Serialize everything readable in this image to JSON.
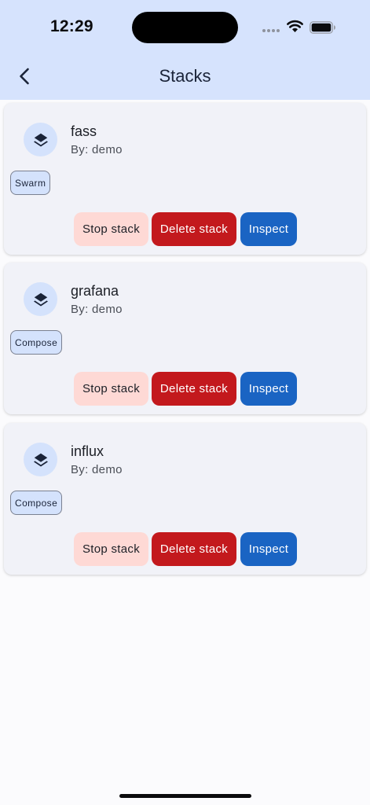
{
  "status_bar": {
    "time": "12:29"
  },
  "header": {
    "title": "Stacks"
  },
  "stacks": [
    {
      "name": "fass",
      "author": "By: demo",
      "type": "Swarm",
      "stop_label": "Stop stack",
      "delete_label": "Delete stack",
      "inspect_label": "Inspect"
    },
    {
      "name": "grafana",
      "author": "By: demo",
      "type": "Compose",
      "stop_label": "Stop stack",
      "delete_label": "Delete stack",
      "inspect_label": "Inspect"
    },
    {
      "name": "influx",
      "author": "By: demo",
      "type": "Compose",
      "stop_label": "Stop stack",
      "delete_label": "Delete stack",
      "inspect_label": "Inspect"
    }
  ],
  "icons": {
    "back": "chevron-left-icon",
    "stack": "layers-icon",
    "wifi": "wifi-icon",
    "battery": "battery-icon"
  },
  "colors": {
    "header_bg": "#d6e3fd",
    "card_bg": "#f1f2f8",
    "stop_bg": "#fed9d5",
    "delete_bg": "#c3191d",
    "inspect_bg": "#1a64c3",
    "badge_bg": "#d4e2fc"
  }
}
